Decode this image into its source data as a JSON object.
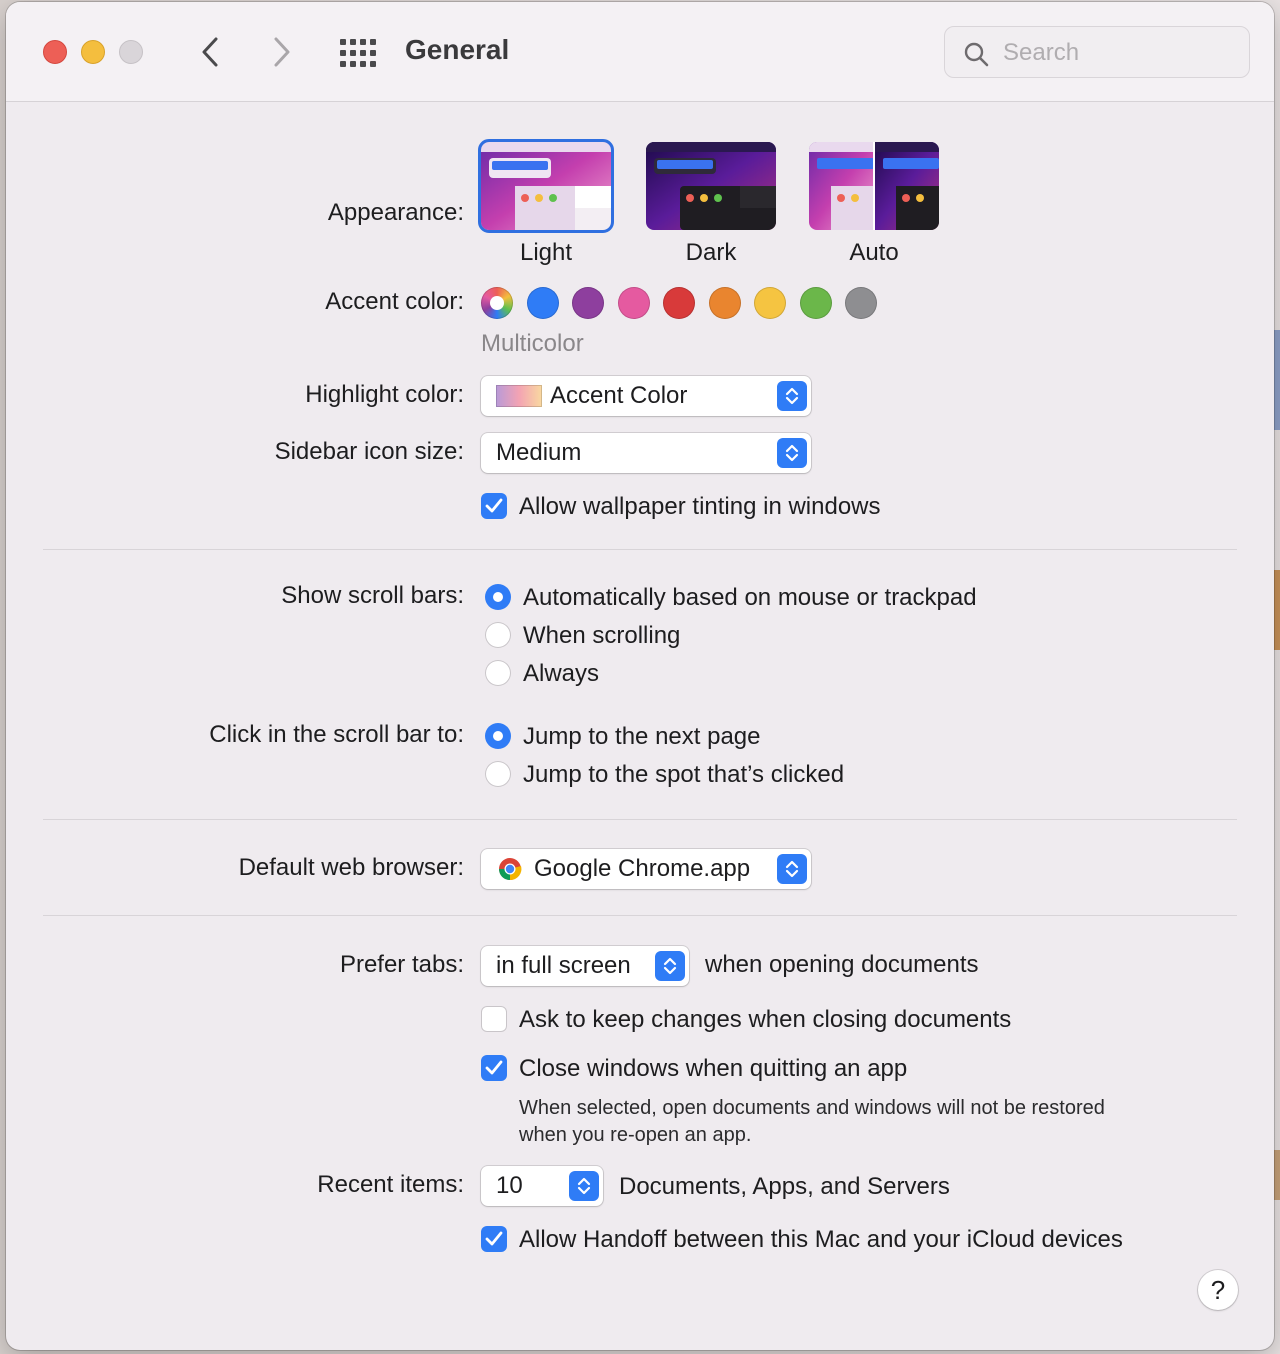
{
  "window": {
    "title": "General",
    "search_placeholder": "Search"
  },
  "appearance": {
    "label": "Appearance:",
    "options": [
      {
        "name": "Light",
        "selected": true
      },
      {
        "name": "Dark",
        "selected": false
      },
      {
        "name": "Auto",
        "selected": false
      }
    ]
  },
  "accent": {
    "label": "Accent color:",
    "selected_name": "Multicolor",
    "colors": [
      "multicolor",
      "#2f7cf6",
      "#8e3f9e",
      "#e55aa0",
      "#d83a3a",
      "#e9852f",
      "#f5c441",
      "#6bb74a",
      "#8e8e91"
    ]
  },
  "highlight": {
    "label": "Highlight color:",
    "value": "Accent Color"
  },
  "sidebar_icon": {
    "label": "Sidebar icon size:",
    "value": "Medium"
  },
  "wallpaper_tinting": {
    "label": "Allow wallpaper tinting in windows",
    "checked": true
  },
  "scroll_bars": {
    "label": "Show scroll bars:",
    "options": [
      "Automatically based on mouse or trackpad",
      "When scrolling",
      "Always"
    ],
    "selected_index": 0
  },
  "click_scroll": {
    "label": "Click in the scroll bar to:",
    "options": [
      "Jump to the next page",
      "Jump to the spot that’s clicked"
    ],
    "selected_index": 0
  },
  "browser": {
    "label": "Default web browser:",
    "value": "Google Chrome.app"
  },
  "prefer_tabs": {
    "label": "Prefer tabs:",
    "value": "in full screen",
    "suffix": "when opening documents"
  },
  "ask_keep_changes": {
    "label": "Ask to keep changes when closing documents",
    "checked": false
  },
  "close_windows": {
    "label": "Close windows when quitting an app",
    "checked": true,
    "description_line1": "When selected, open documents and windows will not be restored",
    "description_line2": "when you re-open an app."
  },
  "recent_items": {
    "label": "Recent items:",
    "value": "10",
    "suffix": "Documents, Apps, and Servers"
  },
  "handoff": {
    "label": "Allow Handoff between this Mac and your iCloud devices",
    "checked": true
  },
  "help": {
    "label": "?"
  }
}
